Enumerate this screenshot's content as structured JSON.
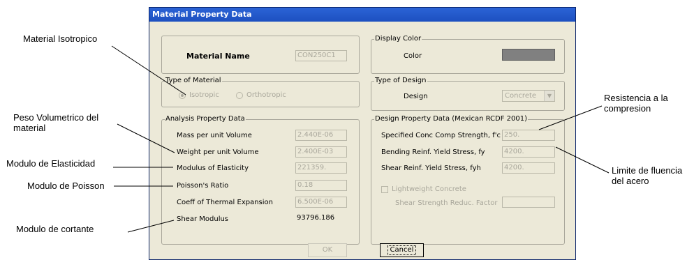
{
  "annotations": {
    "material_isotropico": "Material Isotropico",
    "peso_volumetrico": "Peso Volumetrico del\nmaterial",
    "modulo_elasticidad": "Modulo de Elasticidad",
    "modulo_poisson": "Modulo de Poisson",
    "modulo_cortante": "Modulo de cortante",
    "resistencia_compresion": "Resistencia a la\ncompresion",
    "limite_fluencia": "Limite de fluencia\ndel acero"
  },
  "dialog": {
    "title": "Material Property Data",
    "material_name_label": "Material Name",
    "material_name_value": "CON250C1",
    "display_color": {
      "group_title": "Display Color",
      "color_label": "Color",
      "swatch_color": "#808080"
    },
    "type_of_material": {
      "group_title": "Type of Material",
      "isotropic_label": "Isotropic",
      "orthotropic_label": "Orthotropic",
      "selected": "Isotropic"
    },
    "type_of_design": {
      "group_title": "Type of Design",
      "design_label": "Design",
      "design_value": "Concrete"
    },
    "analysis": {
      "group_title": "Analysis Property Data",
      "rows": [
        {
          "label": "Mass per unit Volume",
          "value": "2.440E-06"
        },
        {
          "label": "Weight per unit Volume",
          "value": "2.400E-03"
        },
        {
          "label": "Modulus of Elasticity",
          "value": "221359."
        },
        {
          "label": "Poisson's Ratio",
          "value": "0.18"
        },
        {
          "label": "Coeff of Thermal Expansion",
          "value": "6.500E-06"
        },
        {
          "label": "Shear Modulus",
          "value": "93796.186"
        }
      ]
    },
    "design": {
      "group_title": "Design Property Data (Mexican RCDF 2001)",
      "rows": [
        {
          "label": "Specified Conc Comp Strength, f'c",
          "value": "250."
        },
        {
          "label": "Bending Reinf. Yield Stress, fy",
          "value": "4200."
        },
        {
          "label": "Shear Reinf. Yield Stress, fyh",
          "value": "4200."
        }
      ],
      "lightweight_label": "Lightweight Concrete",
      "shear_reduc_label": "Shear Strength Reduc. Factor",
      "shear_reduc_value": ""
    },
    "ok_label": "OK",
    "cancel_label": "Cancel"
  }
}
